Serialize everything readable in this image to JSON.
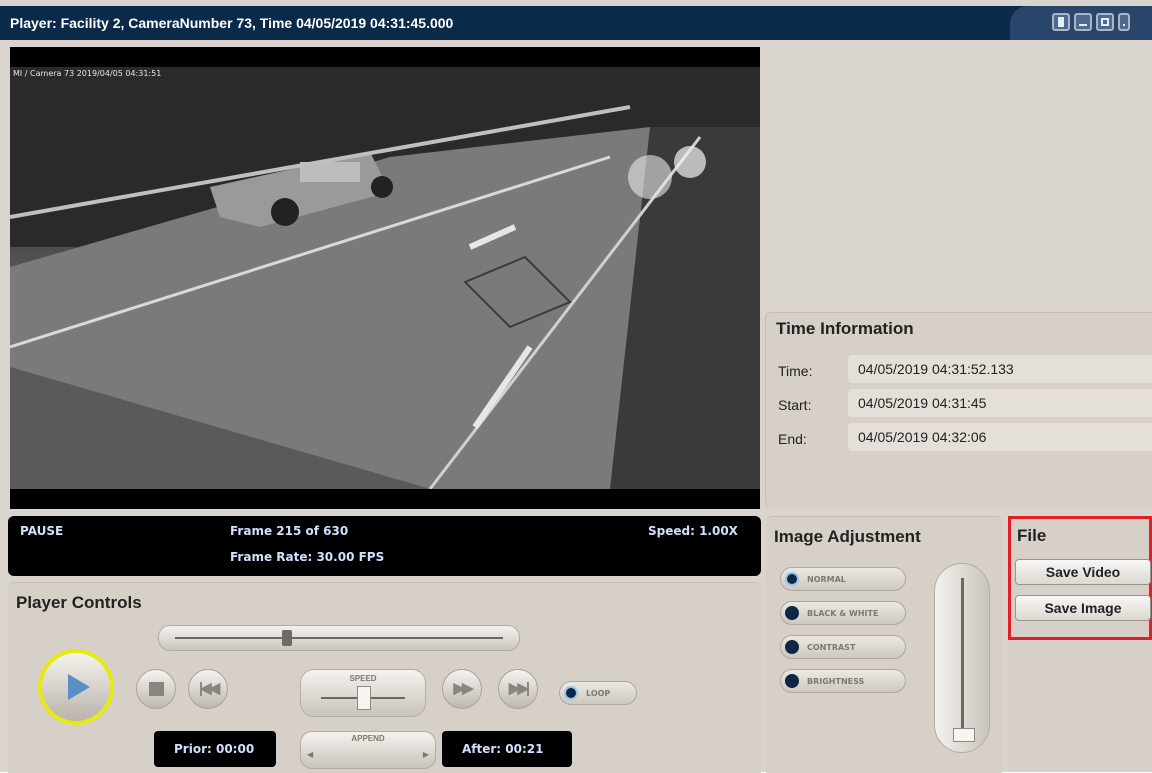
{
  "window": {
    "title": "Player: Facility 2, CameraNumber 73, Time  04/05/2019    04:31:45.000",
    "controls": [
      "document-icon",
      "minimize-icon",
      "maximize-icon",
      "close-icon"
    ]
  },
  "video": {
    "timestamp_overlay": "MI / Camera 73 2019/04/05 04:31:51"
  },
  "time_info": {
    "heading": "Time Information",
    "time_label": "Time:",
    "time_value": "04/05/2019 04:31:52.133",
    "start_label": "Start:",
    "start_value": "04/05/2019 04:31:45",
    "end_label": "End:",
    "end_value": "04/05/2019 04:32:06"
  },
  "status_bar": {
    "state": "PAUSE",
    "frame": "Frame 215 of 630",
    "frame_rate": "Frame Rate: 30.00 FPS",
    "speed": "Speed: 1.00X"
  },
  "player_controls": {
    "heading": "Player Controls",
    "speed_label": "SPEED",
    "loop_label": "LOOP",
    "append_label": "APPEND",
    "prior": "Prior: 00:00",
    "after": "After: 00:21",
    "seek_fraction": 0.34,
    "speed_fraction": 0.5
  },
  "image_adjustment": {
    "heading": "Image Adjustment",
    "options": [
      "NORMAL",
      "BLACK & WHITE",
      "CONTRAST",
      "BRIGHTNESS"
    ],
    "selected": "NORMAL"
  },
  "file": {
    "heading": "File",
    "save_video": "Save Video",
    "save_image": "Save Image"
  },
  "colors": {
    "titlebar": "#0b2a4a",
    "panel": "#d6d0c9",
    "highlight_ring": "#e7ea0f",
    "file_border": "#e31e25",
    "status_text": "#cfe0ff"
  }
}
